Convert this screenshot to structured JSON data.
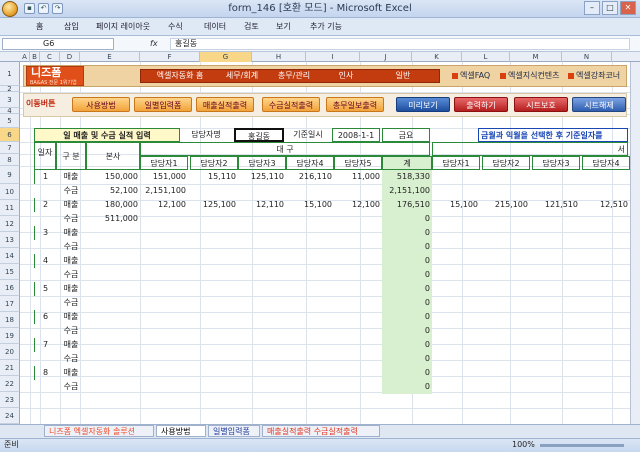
{
  "window": {
    "title": "form_146  [호환 모드] - Microsoft Excel"
  },
  "ribbon_tabs": [
    "홈",
    "삽입",
    "페이지 레이아웃",
    "수식",
    "데이터",
    "검토",
    "보기",
    "추가 기능"
  ],
  "formula_bar": {
    "name_box": "G6",
    "fx": "fx",
    "value": "홍길동"
  },
  "columns": [
    "A",
    "B",
    "C",
    "D",
    "E",
    "F",
    "G",
    "H",
    "I",
    "J",
    "K",
    "L",
    "M",
    "N"
  ],
  "rows": [
    "1",
    "2",
    "3",
    "4",
    "5",
    "6",
    "7",
    "8",
    "9",
    "10",
    "11",
    "12",
    "13",
    "14",
    "15",
    "16",
    "17",
    "18",
    "19",
    "20",
    "21",
    "22",
    "23",
    "24"
  ],
  "banner": {
    "logo": "니즈폼",
    "logo_sub": "BA&AS 전문 1위기업",
    "nav": [
      "엑셀자동화 홈",
      "세무/회계",
      "총무/관리",
      "인사",
      "일반"
    ],
    "links": [
      "엑셀FAQ",
      "엑셀지식컨텐츠",
      "엑셀강좌코너"
    ]
  },
  "toolbar": {
    "label": "이동버튼",
    "buttons": [
      "사용방법",
      "일별입력폼",
      "매출실적출력",
      "수금실적출력",
      "총무일보출력"
    ],
    "actions": [
      "미리보기",
      "출력하기",
      "시트보호",
      "시트해제"
    ]
  },
  "form": {
    "title": "일 매출 및 수금 실적 입력",
    "manager_label": "담당자명",
    "manager": "홍길동",
    "date_label": "기준일시",
    "date": "2008-1-1",
    "dow": "금요",
    "note": "금월과 익월을 선택한 후 기준일자를",
    "hdr_day": "일자",
    "hdr_type": "구 분",
    "hdr_hq": "본사",
    "hdr_dagu": "대 구",
    "hdr_seo": "서",
    "hdr_total": "계",
    "managers": [
      "담당자1",
      "담당자2",
      "담당자3",
      "담당자4",
      "담당자5",
      "담당자1",
      "담당자2",
      "담당자3",
      "담당자4"
    ]
  },
  "table_rows": [
    {
      "day": "1",
      "type": "매출",
      "hq": "150,000",
      "d": [
        "151,000",
        "15,110",
        "125,110",
        "216,110",
        "11,000"
      ],
      "total": "518,330",
      "s": [
        "",
        "",
        "",
        ""
      ]
    },
    {
      "day": "",
      "type": "수금",
      "hq": "52,100",
      "d": [
        "2,151,100",
        "",
        "",
        "",
        ""
      ],
      "total": "2,151,100",
      "s": [
        "",
        "",
        "",
        ""
      ]
    },
    {
      "day": "2",
      "type": "매출",
      "hq": "180,000",
      "d": [
        "12,100",
        "125,100",
        "12,110",
        "15,100",
        "12,100"
      ],
      "total": "176,510",
      "s": [
        "15,100",
        "215,100",
        "121,510",
        "12,510"
      ]
    },
    {
      "day": "",
      "type": "수금",
      "hq": "511,000",
      "d": [
        "",
        "",
        "",
        "",
        ""
      ],
      "total": "0",
      "s": [
        "",
        "",
        "",
        ""
      ]
    },
    {
      "day": "3",
      "type": "매출",
      "hq": "",
      "d": [
        "",
        "",
        "",
        "",
        ""
      ],
      "total": "0",
      "s": [
        "",
        "",
        "",
        ""
      ]
    },
    {
      "day": "",
      "type": "수금",
      "hq": "",
      "d": [
        "",
        "",
        "",
        "",
        ""
      ],
      "total": "0",
      "s": [
        "",
        "",
        "",
        ""
      ]
    },
    {
      "day": "4",
      "type": "매출",
      "hq": "",
      "d": [
        "",
        "",
        "",
        "",
        ""
      ],
      "total": "0",
      "s": [
        "",
        "",
        "",
        ""
      ]
    },
    {
      "day": "",
      "type": "수금",
      "hq": "",
      "d": [
        "",
        "",
        "",
        "",
        ""
      ],
      "total": "0",
      "s": [
        "",
        "",
        "",
        ""
      ]
    },
    {
      "day": "5",
      "type": "매출",
      "hq": "",
      "d": [
        "",
        "",
        "",
        "",
        ""
      ],
      "total": "0",
      "s": [
        "",
        "",
        "",
        ""
      ]
    },
    {
      "day": "",
      "type": "수금",
      "hq": "",
      "d": [
        "",
        "",
        "",
        "",
        ""
      ],
      "total": "0",
      "s": [
        "",
        "",
        "",
        ""
      ]
    },
    {
      "day": "6",
      "type": "매출",
      "hq": "",
      "d": [
        "",
        "",
        "",
        "",
        ""
      ],
      "total": "0",
      "s": [
        "",
        "",
        "",
        ""
      ]
    },
    {
      "day": "",
      "type": "수금",
      "hq": "",
      "d": [
        "",
        "",
        "",
        "",
        ""
      ],
      "total": "0",
      "s": [
        "",
        "",
        "",
        ""
      ]
    },
    {
      "day": "7",
      "type": "매출",
      "hq": "",
      "d": [
        "",
        "",
        "",
        "",
        ""
      ],
      "total": "0",
      "s": [
        "",
        "",
        "",
        ""
      ]
    },
    {
      "day": "",
      "type": "수금",
      "hq": "",
      "d": [
        "",
        "",
        "",
        "",
        ""
      ],
      "total": "0",
      "s": [
        "",
        "",
        "",
        ""
      ]
    },
    {
      "day": "8",
      "type": "매출",
      "hq": "",
      "d": [
        "",
        "",
        "",
        "",
        ""
      ],
      "total": "0",
      "s": [
        "",
        "",
        "",
        ""
      ]
    },
    {
      "day": "",
      "type": "수금",
      "hq": "",
      "d": [
        "",
        "",
        "",
        "",
        ""
      ],
      "total": "0",
      "s": [
        "",
        "",
        "",
        ""
      ]
    }
  ],
  "sheet_tabs": [
    "니즈폼 엑셀자동화 솔루션",
    "사용방법",
    "일별입력폼",
    "매출실적출력 수금실적출력"
  ],
  "status": {
    "left": "준비",
    "zoom": "100%"
  }
}
